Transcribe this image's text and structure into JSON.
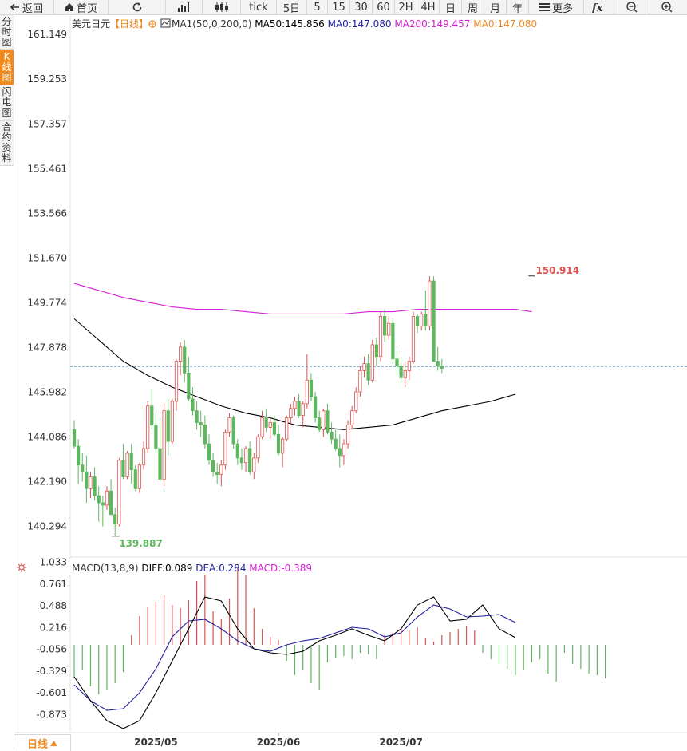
{
  "toolbar": {
    "back": "返回",
    "home": "首页",
    "tick": "tick",
    "periods": [
      "5日",
      "5",
      "15",
      "30",
      "60",
      "2H",
      "4H",
      "日",
      "周",
      "月",
      "年"
    ],
    "more": "更多"
  },
  "side_tabs": [
    "分时图",
    "K线图",
    "闪电图",
    "合约资料"
  ],
  "bottom_tab": "日线",
  "colors": {
    "up": "#d9534f",
    "down": "#5cb85c",
    "ma50": "#000000",
    "ma200": "#d61fd6",
    "dif": "#000000",
    "dea": "#1f1f9e",
    "accent": "#f08a1e"
  },
  "header": {
    "symbol": "美元日元",
    "period": "【日线】",
    "ma_title": "MA1(50,0,200,0)",
    "ma50": "MA50:145.856",
    "ma0a": "MA0:147.080",
    "ma200": "MA200:149.457",
    "ma0b": "MA0:147.080"
  },
  "macd_header": {
    "title": "MACD(13,8,9)",
    "diff": "DIFF:0.089",
    "dea": "DEA:0.284",
    "macd": "MACD:-0.389"
  },
  "chart_data": [
    {
      "type": "candlestick",
      "ylim": [
        139.0,
        162.0
      ],
      "yticks": [
        "161.149",
        "159.253",
        "157.357",
        "155.461",
        "153.566",
        "151.670",
        "149.774",
        "147.878",
        "145.982",
        "144.086",
        "142.190",
        "140.294"
      ],
      "xticks": [
        {
          "index": 20,
          "label": "2025/05"
        },
        {
          "index": 50,
          "label": "2025/06"
        },
        {
          "index": 80,
          "label": "2025/07"
        }
      ],
      "high_label": {
        "index": 112,
        "value": "150.914"
      },
      "low_label": {
        "index": 10,
        "value": "139.887"
      },
      "current_price": 147.08,
      "ohlc": [
        [
          144.4,
          144.8,
          143.6,
          143.7
        ],
        [
          143.7,
          144.0,
          142.1,
          142.9
        ],
        [
          142.9,
          143.4,
          142.2,
          142.6
        ],
        [
          142.6,
          143.3,
          141.3,
          141.9
        ],
        [
          141.9,
          142.6,
          141.5,
          142.4
        ],
        [
          142.4,
          142.8,
          141.4,
          141.6
        ],
        [
          141.6,
          142.0,
          140.5,
          141.3
        ],
        [
          141.3,
          141.6,
          140.3,
          141.2
        ],
        [
          141.2,
          142.0,
          141.0,
          141.8
        ],
        [
          141.8,
          142.3,
          140.8,
          140.8
        ],
        [
          140.8,
          141.1,
          139.9,
          140.4
        ],
        [
          140.4,
          143.2,
          140.3,
          143.1
        ],
        [
          143.1,
          143.8,
          142.3,
          142.4
        ],
        [
          142.4,
          143.5,
          142.3,
          143.4
        ],
        [
          143.4,
          143.8,
          142.1,
          142.7
        ],
        [
          142.7,
          142.9,
          141.8,
          141.9
        ],
        [
          141.9,
          143.0,
          141.7,
          142.9
        ],
        [
          142.9,
          143.9,
          142.7,
          143.6
        ],
        [
          143.6,
          145.6,
          143.4,
          145.4
        ],
        [
          145.4,
          146.1,
          144.4,
          144.6
        ],
        [
          144.6,
          145.1,
          143.4,
          143.6
        ],
        [
          143.6,
          144.9,
          142.2,
          142.3
        ],
        [
          142.3,
          145.5,
          142.0,
          145.2
        ],
        [
          145.2,
          145.7,
          143.3,
          143.9
        ],
        [
          143.9,
          145.7,
          143.8,
          145.6
        ],
        [
          145.6,
          147.4,
          145.2,
          147.3
        ],
        [
          147.3,
          148.1,
          146.7,
          147.9
        ],
        [
          147.9,
          148.2,
          146.4,
          146.8
        ],
        [
          146.8,
          147.5,
          145.6,
          145.7
        ],
        [
          145.7,
          146.2,
          145.0,
          145.2
        ],
        [
          145.2,
          145.6,
          144.4,
          144.7
        ],
        [
          144.7,
          145.2,
          144.1,
          144.6
        ],
        [
          144.6,
          145.0,
          143.6,
          143.8
        ],
        [
          143.8,
          144.2,
          142.9,
          143.1
        ],
        [
          143.1,
          143.4,
          142.4,
          142.6
        ],
        [
          142.6,
          143.0,
          142.1,
          142.5
        ],
        [
          142.5,
          143.1,
          142.0,
          142.9
        ],
        [
          142.9,
          144.4,
          142.7,
          144.3
        ],
        [
          144.3,
          145.1,
          144.1,
          144.9
        ],
        [
          144.9,
          145.0,
          143.6,
          143.8
        ],
        [
          143.8,
          144.0,
          142.9,
          143.2
        ],
        [
          143.2,
          143.6,
          142.7,
          143.0
        ],
        [
          143.0,
          143.7,
          142.6,
          143.6
        ],
        [
          143.6,
          143.9,
          142.5,
          142.6
        ],
        [
          142.6,
          143.4,
          142.3,
          143.2
        ],
        [
          143.2,
          144.2,
          143.0,
          144.1
        ],
        [
          144.1,
          145.2,
          144.0,
          144.9
        ],
        [
          144.9,
          145.3,
          144.3,
          144.5
        ],
        [
          144.5,
          144.9,
          144.0,
          144.7
        ],
        [
          144.7,
          145.0,
          144.1,
          144.2
        ],
        [
          144.2,
          144.6,
          143.3,
          143.4
        ],
        [
          143.4,
          144.1,
          142.8,
          144.0
        ],
        [
          144.0,
          145.0,
          143.9,
          144.9
        ],
        [
          144.9,
          145.5,
          144.6,
          145.3
        ],
        [
          145.3,
          145.8,
          145.0,
          145.6
        ],
        [
          145.6,
          145.9,
          144.9,
          145.0
        ],
        [
          145.0,
          145.6,
          144.5,
          145.5
        ],
        [
          145.5,
          147.6,
          145.3,
          146.5
        ],
        [
          146.5,
          146.8,
          145.6,
          145.8
        ],
        [
          145.8,
          146.0,
          144.7,
          144.9
        ],
        [
          144.9,
          145.2,
          144.3,
          144.4
        ],
        [
          144.4,
          145.3,
          144.1,
          145.2
        ],
        [
          145.2,
          145.5,
          144.2,
          144.3
        ],
        [
          144.3,
          144.7,
          143.8,
          144.0
        ],
        [
          144.0,
          144.4,
          143.5,
          143.6
        ],
        [
          143.6,
          144.2,
          142.8,
          143.3
        ],
        [
          143.3,
          144.0,
          142.9,
          143.8
        ],
        [
          143.8,
          144.8,
          143.6,
          144.6
        ],
        [
          144.6,
          145.4,
          144.4,
          145.2
        ],
        [
          145.2,
          146.2,
          145.1,
          146.0
        ],
        [
          146.0,
          147.1,
          145.8,
          146.9
        ],
        [
          146.9,
          147.5,
          146.6,
          147.2
        ],
        [
          147.2,
          147.6,
          146.3,
          146.5
        ],
        [
          146.5,
          148.2,
          146.4,
          148.0
        ],
        [
          148.0,
          148.3,
          147.1,
          147.5
        ],
        [
          147.5,
          149.4,
          147.3,
          149.2
        ],
        [
          149.2,
          149.5,
          148.1,
          148.4
        ],
        [
          148.4,
          149.2,
          148.2,
          148.9
        ],
        [
          148.9,
          149.1,
          147.2,
          147.4
        ],
        [
          147.4,
          147.8,
          146.7,
          147.1
        ],
        [
          147.1,
          147.5,
          146.4,
          146.6
        ],
        [
          146.6,
          147.3,
          146.2,
          146.9
        ],
        [
          146.9,
          147.5,
          146.5,
          147.3
        ],
        [
          147.3,
          149.4,
          147.2,
          149.2
        ],
        [
          149.2,
          149.3,
          148.5,
          148.8
        ],
        [
          148.8,
          149.4,
          148.6,
          149.3
        ],
        [
          149.3,
          150.3,
          148.6,
          148.8
        ],
        [
          148.8,
          150.9,
          148.6,
          150.7
        ],
        [
          150.7,
          150.9,
          147.4,
          147.3
        ],
        [
          147.3,
          147.9,
          146.9,
          147.1
        ],
        [
          147.1,
          147.4,
          146.8,
          147.0
        ]
      ],
      "ma50": [
        [
          0,
          149.1
        ],
        [
          6,
          148.2
        ],
        [
          12,
          147.3
        ],
        [
          18,
          146.7
        ],
        [
          24,
          146.2
        ],
        [
          30,
          145.8
        ],
        [
          36,
          145.4
        ],
        [
          42,
          145.1
        ],
        [
          48,
          144.9
        ],
        [
          54,
          144.6
        ],
        [
          60,
          144.5
        ],
        [
          66,
          144.4
        ],
        [
          72,
          144.5
        ],
        [
          78,
          144.6
        ],
        [
          84,
          144.9
        ],
        [
          90,
          145.2
        ],
        [
          96,
          145.4
        ],
        [
          102,
          145.6
        ],
        [
          108,
          145.9
        ]
      ],
      "ma200": [
        [
          0,
          150.6
        ],
        [
          6,
          150.3
        ],
        [
          12,
          150.0
        ],
        [
          18,
          149.8
        ],
        [
          24,
          149.6
        ],
        [
          30,
          149.5
        ],
        [
          36,
          149.5
        ],
        [
          42,
          149.4
        ],
        [
          48,
          149.3
        ],
        [
          54,
          149.3
        ],
        [
          60,
          149.3
        ],
        [
          66,
          149.3
        ],
        [
          72,
          149.4
        ],
        [
          78,
          149.4
        ],
        [
          84,
          149.5
        ],
        [
          90,
          149.5
        ],
        [
          96,
          149.5
        ],
        [
          102,
          149.5
        ],
        [
          108,
          149.5
        ],
        [
          112,
          149.4
        ]
      ]
    },
    {
      "type": "macd",
      "ylim": [
        -1.1,
        1.06
      ],
      "yticks": [
        "1.033",
        "0.761",
        "0.488",
        "0.216",
        "-0.056",
        "-0.329",
        "-0.601",
        "-0.873"
      ],
      "hist": [
        [
          0,
          -0.42
        ],
        [
          2,
          -0.32
        ],
        [
          4,
          -0.52
        ],
        [
          6,
          -0.62
        ],
        [
          8,
          -0.56
        ],
        [
          10,
          -0.48
        ],
        [
          12,
          -0.34
        ],
        [
          14,
          0.12
        ],
        [
          16,
          0.36
        ],
        [
          18,
          0.48
        ],
        [
          20,
          0.54
        ],
        [
          22,
          0.62
        ],
        [
          24,
          0.5
        ],
        [
          26,
          0.46
        ],
        [
          28,
          0.56
        ],
        [
          30,
          0.8
        ],
        [
          32,
          0.88
        ],
        [
          34,
          0.42
        ],
        [
          36,
          0.32
        ],
        [
          38,
          0.58
        ],
        [
          40,
          0.96
        ],
        [
          42,
          0.88
        ],
        [
          44,
          0.46
        ],
        [
          46,
          0.2
        ],
        [
          48,
          0.1
        ],
        [
          50,
          0.06
        ],
        [
          52,
          -0.2
        ],
        [
          54,
          -0.38
        ],
        [
          56,
          -0.32
        ],
        [
          58,
          -0.48
        ],
        [
          60,
          -0.56
        ],
        [
          62,
          -0.22
        ],
        [
          64,
          -0.16
        ],
        [
          66,
          -0.14
        ],
        [
          68,
          -0.18
        ],
        [
          70,
          -0.1
        ],
        [
          72,
          -0.12
        ],
        [
          74,
          -0.18
        ],
        [
          76,
          0.12
        ],
        [
          78,
          0.16
        ],
        [
          80,
          0.2
        ],
        [
          82,
          0.18
        ],
        [
          84,
          0.22
        ],
        [
          86,
          0.08
        ],
        [
          88,
          0.04
        ],
        [
          90,
          0.12
        ],
        [
          92,
          0.16
        ],
        [
          94,
          0.2
        ],
        [
          96,
          0.24
        ],
        [
          98,
          0.18
        ],
        [
          100,
          -0.1
        ],
        [
          102,
          -0.18
        ],
        [
          104,
          -0.24
        ],
        [
          106,
          -0.3
        ],
        [
          108,
          -0.38
        ],
        [
          110,
          -0.32
        ],
        [
          112,
          -0.22
        ],
        [
          114,
          -0.18
        ],
        [
          116,
          -0.36
        ],
        [
          118,
          -0.46
        ],
        [
          120,
          -0.1
        ],
        [
          122,
          -0.24
        ],
        [
          124,
          -0.3
        ],
        [
          126,
          -0.36
        ],
        [
          128,
          -0.38
        ],
        [
          130,
          -0.42
        ]
      ],
      "dif": [
        [
          0,
          -0.4
        ],
        [
          4,
          -0.7
        ],
        [
          8,
          -0.95
        ],
        [
          12,
          -1.05
        ],
        [
          16,
          -0.95
        ],
        [
          20,
          -0.6
        ],
        [
          24,
          -0.2
        ],
        [
          28,
          0.2
        ],
        [
          32,
          0.6
        ],
        [
          36,
          0.55
        ],
        [
          40,
          0.2
        ],
        [
          44,
          -0.05
        ],
        [
          48,
          -0.1
        ],
        [
          52,
          -0.12
        ],
        [
          56,
          -0.08
        ],
        [
          60,
          0.05
        ],
        [
          64,
          0.12
        ],
        [
          68,
          0.2
        ],
        [
          72,
          0.12
        ],
        [
          76,
          0.05
        ],
        [
          80,
          0.2
        ],
        [
          84,
          0.5
        ],
        [
          88,
          0.6
        ],
        [
          92,
          0.3
        ],
        [
          96,
          0.32
        ],
        [
          100,
          0.5
        ],
        [
          104,
          0.2
        ],
        [
          108,
          0.09
        ]
      ],
      "dea": [
        [
          0,
          -0.5
        ],
        [
          4,
          -0.7
        ],
        [
          8,
          -0.82
        ],
        [
          12,
          -0.8
        ],
        [
          16,
          -0.6
        ],
        [
          20,
          -0.3
        ],
        [
          24,
          0.1
        ],
        [
          28,
          0.3
        ],
        [
          32,
          0.32
        ],
        [
          36,
          0.2
        ],
        [
          40,
          0.05
        ],
        [
          44,
          -0.05
        ],
        [
          48,
          -0.08
        ],
        [
          52,
          0.0
        ],
        [
          56,
          0.05
        ],
        [
          60,
          0.08
        ],
        [
          64,
          0.15
        ],
        [
          68,
          0.22
        ],
        [
          72,
          0.2
        ],
        [
          76,
          0.1
        ],
        [
          80,
          0.15
        ],
        [
          84,
          0.35
        ],
        [
          88,
          0.5
        ],
        [
          92,
          0.45
        ],
        [
          96,
          0.35
        ],
        [
          100,
          0.36
        ],
        [
          104,
          0.38
        ],
        [
          108,
          0.28
        ]
      ]
    }
  ]
}
